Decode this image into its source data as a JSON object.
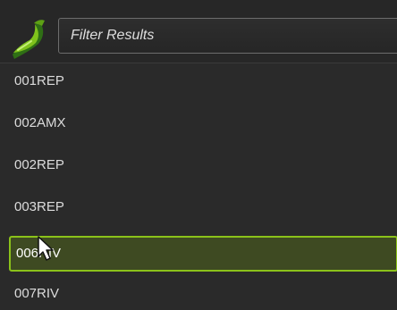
{
  "filter": {
    "placeholder": "Filter Results",
    "value": ""
  },
  "results": {
    "items": [
      {
        "label": "001REP",
        "selected": false
      },
      {
        "label": "002AMX",
        "selected": false
      },
      {
        "label": "002REP",
        "selected": false
      },
      {
        "label": "003REP",
        "selected": false
      },
      {
        "label": "006RIV",
        "selected": true
      },
      {
        "label": "007RIV",
        "selected": false
      }
    ]
  },
  "colors": {
    "background": "#2a2a2a",
    "text": "#dcdcdc",
    "accent": "#8bc21a",
    "selected_background": "#3e4a22",
    "logo": "#7fc31c"
  },
  "icons": {
    "logo": "green-swoosh-logo",
    "cursor": "arrow-pointer"
  }
}
